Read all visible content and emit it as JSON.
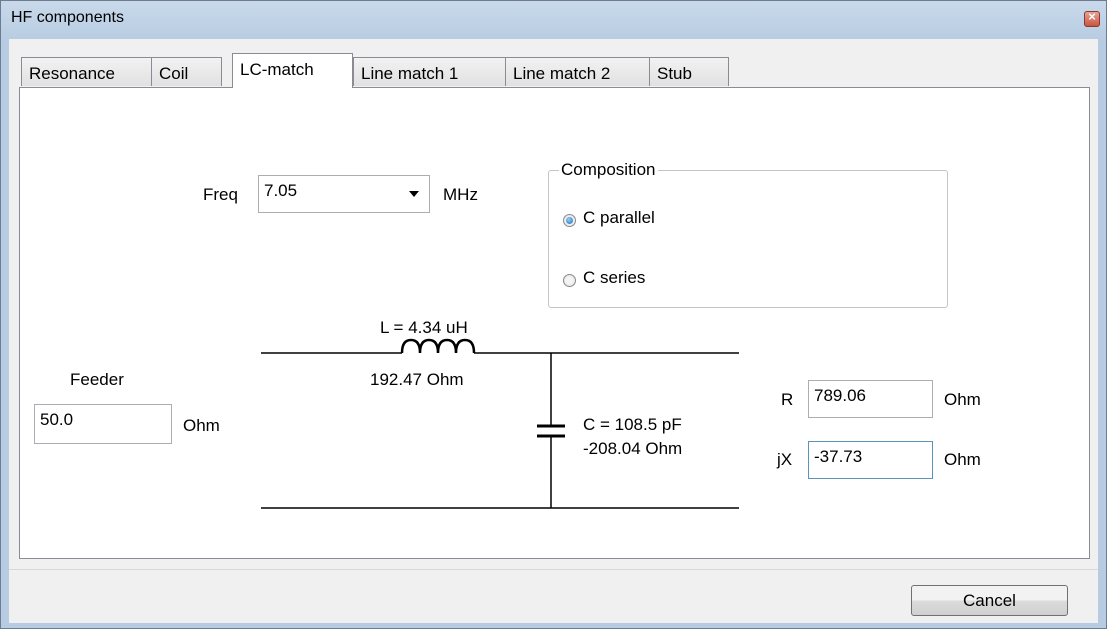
{
  "window": {
    "title": "HF components",
    "close_glyph": "×"
  },
  "tabs": [
    {
      "label": "Resonance"
    },
    {
      "label": "Coil"
    },
    {
      "label": "LC-match"
    },
    {
      "label": "Line match  1"
    },
    {
      "label": "Line match 2"
    },
    {
      "label": "Stub"
    }
  ],
  "active_tab": "LC-match",
  "freq": {
    "label": "Freq",
    "value": "7.05",
    "unit": "MHz"
  },
  "composition": {
    "title": "Composition",
    "options": [
      {
        "label": "C parallel",
        "checked": true
      },
      {
        "label": "C series",
        "checked": false
      }
    ]
  },
  "feeder": {
    "label": "Feeder",
    "value": "50.0",
    "unit": "Ohm"
  },
  "circuit": {
    "inductor_label": "L = 4.34 uH",
    "inductor_reactance": "192.47 Ohm",
    "capacitor_label": "C = 108.5 pF",
    "capacitor_reactance": "-208.04 Ohm"
  },
  "load": {
    "r_label": "R",
    "r_value": "789.06",
    "r_unit": "Ohm",
    "jx_label": "jX",
    "jx_value": "-37.73",
    "jx_unit": "Ohm"
  },
  "buttons": {
    "cancel": "Cancel"
  }
}
